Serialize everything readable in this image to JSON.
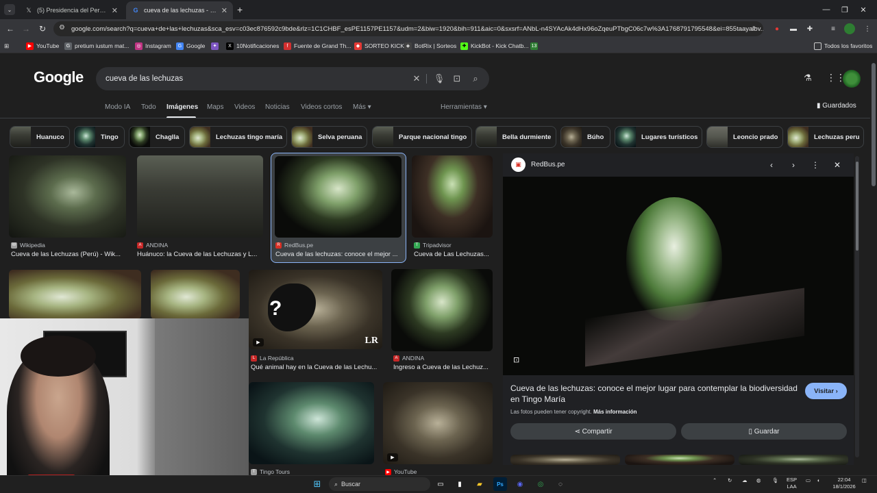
{
  "browser": {
    "tabs": [
      {
        "title": "(5) Presidencia del Perú 🇵🇪 (@p",
        "icon": "x-icon"
      },
      {
        "title": "cueva de las lechuzas - Buscar c",
        "icon": "google-icon"
      }
    ],
    "new_tab_label": "+",
    "url": "google.com/search?q=cueva+de+las+lechuzas&sca_esv=c03ec876592c9bde&rlz=1C1CHBF_esPE1157PE1157&udm=2&biw=1920&bih=911&aic=0&sxsrf=ANbL-n4SYAcAk4dHx96oZqeuPTbgC06c7w%3A1768791795548&ei=855taayalbv...",
    "bookmarks": [
      {
        "label": "YouTube",
        "color": "#ff0000",
        "glyph": "▶"
      },
      {
        "label": "pretium iustum mat...",
        "color": "#5f6368",
        "glyph": "G"
      },
      {
        "label": "Instagram",
        "color": "#c13584",
        "glyph": "◎"
      },
      {
        "label": "Google",
        "color": "#4285f4",
        "glyph": "G"
      },
      {
        "label": "",
        "color": "#7e57c2",
        "glyph": "✦"
      },
      {
        "label": "10Notificaciones",
        "color": "#000000",
        "glyph": "X"
      },
      {
        "label": "Fuente de Grand Th...",
        "color": "#d32f2f",
        "glyph": "f"
      },
      {
        "label": "SORTEO KICK",
        "color": "#e53935",
        "glyph": "◆"
      },
      {
        "label": "BotRix | Sorteos",
        "color": "#424242",
        "glyph": "◈"
      },
      {
        "label": "KickBot - Kick Chatb...",
        "color": "#53fc18",
        "glyph": "✚"
      },
      {
        "label": "",
        "color": "#2e7d32",
        "glyph": "13"
      }
    ],
    "all_bookmarks_label": "Todos los favoritos"
  },
  "google": {
    "logo": "Google",
    "query": "cueva de las lechuzas",
    "nav_tabs": [
      "Modo IA",
      "Todo",
      "Imágenes",
      "Maps",
      "Videos",
      "Noticias",
      "Videos cortos",
      "Más ▾"
    ],
    "active_tab": "Imágenes",
    "tools_label": "Herramientas ▾",
    "saved_label": "Guardados",
    "chips": [
      "Huanuco",
      "Tingo",
      "Chaglla",
      "Lechuzas tingo maría",
      "Selva peruana",
      "Parque nacional tingo",
      "Bella durmiente",
      "Búho",
      "Lugares turísticos",
      "Leoncio prado",
      "Lechuzas peru"
    ],
    "results": [
      {
        "source": "Wikipedia",
        "title": "Cueva de las Lechuzas (Perú) - Wik...",
        "src_color": "#9e9e9e",
        "src_glyph": "W"
      },
      {
        "source": "ANDINA",
        "title": "Huánuco: la Cueva de las Lechuzas y L...",
        "src_color": "#c62828",
        "src_glyph": "A"
      },
      {
        "source": "RedBus.pe",
        "title": "Cueva de las lechuzas: conoce el mejor ...",
        "src_color": "#d93025",
        "src_glyph": "R"
      },
      {
        "source": "Tripadvisor",
        "title": "Cueva de Las Lechuzas...",
        "src_color": "#34a853",
        "src_glyph": "T"
      },
      {
        "source": "La República",
        "title": "Qué animal hay en la Cueva de las Lechu...",
        "src_color": "#c62828",
        "src_glyph": "LR"
      },
      {
        "source": "ANDINA",
        "title": "Ingreso a Cueva de las Lechuz...",
        "src_color": "#c62828",
        "src_glyph": "A"
      },
      {
        "source": "Tingo Tours",
        "title": "",
        "src_color": "#9e9e9e",
        "src_glyph": "T"
      },
      {
        "source": "YouTube",
        "title": "",
        "src_color": "#ff0000",
        "src_glyph": "▶"
      }
    ],
    "lr_watermark": "LR",
    "question_mark": "?"
  },
  "preview": {
    "source": "RedBus.pe",
    "source_glyph": "▣",
    "title": "Cueva de las lechuzas: conoce el mejor lugar para contemplar la biodiversidad en Tingo María",
    "visit_label": "Visitar ›",
    "copyright": "Las fotos pueden tener copyright.",
    "more_info": "Más información",
    "share_label": "Compartir",
    "save_label": "Guardar"
  },
  "taskbar": {
    "search_label": "Buscar",
    "lang_top": "ESP",
    "lang_bottom": "LAA",
    "time": "22:04",
    "date": "18/1/2026"
  },
  "colors": {
    "accent": "#8ab4f8",
    "page_bg": "#1f1f1f",
    "redbus": "#d93025"
  }
}
